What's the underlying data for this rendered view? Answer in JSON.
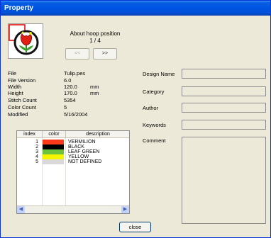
{
  "window": {
    "title": "Property"
  },
  "navigation": {
    "hoop_label": "About hoop position",
    "page_label": "1 / 4",
    "prev_label": "<<",
    "next_label": ">>"
  },
  "info": [
    {
      "label": "File",
      "value": "Tulip.pes",
      "unit": ""
    },
    {
      "label": "File Version",
      "value": "6.0",
      "unit": ""
    },
    {
      "label": "Width",
      "value": "120.0",
      "unit": "mm"
    },
    {
      "label": "Height",
      "value": "170.0",
      "unit": "mm"
    },
    {
      "label": "Stitch Count",
      "value": "5354",
      "unit": ""
    },
    {
      "label": "Color Count",
      "value": "5",
      "unit": ""
    },
    {
      "label": "Modified",
      "value": "5/16/2004",
      "unit": ""
    }
  ],
  "colors_table": {
    "headers": [
      "index",
      "color",
      "description"
    ],
    "rows": [
      {
        "index": "1",
        "color": "#ff3a1a",
        "description": "VERMILION"
      },
      {
        "index": "2",
        "color": "#000000",
        "description": "BLACK"
      },
      {
        "index": "3",
        "color": "#6cc23a",
        "description": "LEAF GREEN"
      },
      {
        "index": "4",
        "color": "#f5f500",
        "description": "YELLOW"
      },
      {
        "index": "5",
        "color": "#d9d9d9",
        "description": "NOT DEFINED"
      }
    ]
  },
  "fields": [
    {
      "label": "Design Name",
      "value": ""
    },
    {
      "label": "Category",
      "value": ""
    },
    {
      "label": "Author",
      "value": ""
    },
    {
      "label": "Keywords",
      "value": ""
    }
  ],
  "comment": {
    "label": "Comment",
    "value": ""
  },
  "buttons": {
    "close_label": "close"
  },
  "colors": {
    "titlebar": "#0054e3",
    "dialog_bg": "#ece9d8"
  }
}
